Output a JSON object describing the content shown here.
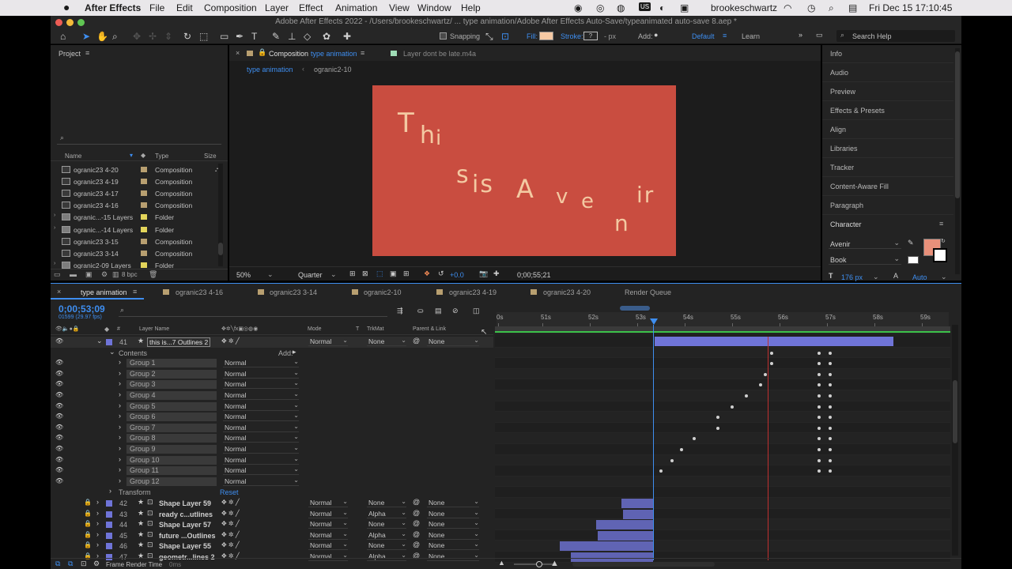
{
  "menubar": {
    "app": "After Effects",
    "items": [
      "File",
      "Edit",
      "Composition",
      "Layer",
      "Effect",
      "Animation",
      "View",
      "Window",
      "Help"
    ],
    "user": "brookeschwartz",
    "clock": "Fri Dec 15  17:10:45"
  },
  "window_title": "Adobe After Effects 2022 - /Users/brookeschwartz/ ... type animation/Adobe After Effects Auto-Save/typeanimated auto-save 8.aep *",
  "toolbar": {
    "snapping": "Snapping",
    "fill": "Fill:",
    "stroke": "Stroke:",
    "stroke_units": "- px",
    "add": "Add:",
    "workspace_default": "Default",
    "workspace_learn": "Learn",
    "search_placeholder": "Search Help",
    "fill_color": "#f6c9a4"
  },
  "project": {
    "title": "Project",
    "columns": {
      "name": "Name",
      "type": "Type",
      "size": "Size"
    },
    "items": [
      {
        "name": "ogranic23 4-20",
        "type": "Composition",
        "color": "#b89f70"
      },
      {
        "name": "ogranic23 4-19",
        "type": "Composition",
        "color": "#b89f70"
      },
      {
        "name": "ogranic23 4-17",
        "type": "Composition",
        "color": "#b89f70"
      },
      {
        "name": "ogranic23 4-16",
        "type": "Composition",
        "color": "#b89f70"
      },
      {
        "name": "ogranic...-15 Layers",
        "type": "Folder",
        "color": "#e3d55a"
      },
      {
        "name": "ogranic...-14 Layers",
        "type": "Folder",
        "color": "#e3d55a"
      },
      {
        "name": "ogranic23 3-15",
        "type": "Composition",
        "color": "#b89f70"
      },
      {
        "name": "ogranic23 3-14",
        "type": "Composition",
        "color": "#b89f70"
      },
      {
        "name": "ogranic2-09 Layers",
        "type": "Folder",
        "color": "#e3d55a"
      }
    ],
    "bpc": "8 bpc"
  },
  "viewer": {
    "tab_label_prefix": "Composition",
    "tab_comp": "type animation",
    "tab_layer": "Layer dont be late.m4a",
    "crumb1": "type animation",
    "crumb2": "ogranic2-10",
    "bg_color": "#c94d40",
    "text_color": "#f3c9a2",
    "glyphs": [
      {
        "c": "T"
      },
      {
        "c": "h"
      },
      {
        "c": "i"
      },
      {
        "c": "s"
      },
      {
        "c": "is"
      },
      {
        "c": "A"
      },
      {
        "c": "v"
      },
      {
        "c": "e"
      },
      {
        "c": "n"
      },
      {
        "c": "ir"
      }
    ],
    "zoom": "50%",
    "resolution": "Quarter",
    "exposure": "+0.0",
    "timecode": "0;00;55;21"
  },
  "right_panel": {
    "items": [
      "Info",
      "Audio",
      "Preview",
      "Effects & Presets",
      "Align",
      "Libraries",
      "Tracker",
      "Content-Aware Fill",
      "Paragraph"
    ],
    "character_title": "Character",
    "font": "Avenir",
    "style": "Book",
    "size": "176 px",
    "leading": "Auto",
    "swatch_color": "#e8907a"
  },
  "timeline": {
    "tabs": [
      "type animation",
      "ogranic23 4-16",
      "ogranic23 3-14",
      "ogranic2-10",
      "ogranic23 4-19",
      "ogranic23 4-20",
      "Render Queue"
    ],
    "timecode": "0;00;53;09",
    "frames": "01599 (29.97 fps)",
    "columns": {
      "layer_name": "Layer Name",
      "mode": "Mode",
      "t": "T",
      "trkmat": "TrkMat",
      "parent": "Parent & Link",
      "num": "#"
    },
    "ruler": [
      "0s",
      "51s",
      "52s",
      "53s",
      "54s",
      "55s",
      "56s",
      "57s",
      "58s",
      "59s"
    ],
    "main_layer": {
      "num": "41",
      "name": "this is...7 Outlines 2",
      "mode": "Normal",
      "trkmat": "None",
      "parent": "None"
    },
    "contents": "Contents",
    "add": "Add:",
    "groups": [
      "Group 1",
      "Group 2",
      "Group 3",
      "Group 4",
      "Group 5",
      "Group 6",
      "Group 7",
      "Group 8",
      "Group 9",
      "Group 10",
      "Group 11",
      "Group 12"
    ],
    "group_mode": "Normal",
    "transform": "Transform",
    "reset": "Reset",
    "layers": [
      {
        "num": "42",
        "name": "Shape Layer 59",
        "mode": "Normal",
        "trkmat": "None",
        "parent": "None"
      },
      {
        "num": "43",
        "name": "ready c...utlines",
        "mode": "Normal",
        "trkmat": "Alpha",
        "parent": "None"
      },
      {
        "num": "44",
        "name": "Shape Layer 57",
        "mode": "Normal",
        "trkmat": "None",
        "parent": "None"
      },
      {
        "num": "45",
        "name": "future ...Outlines",
        "mode": "Normal",
        "trkmat": "Alpha",
        "parent": "None"
      },
      {
        "num": "46",
        "name": "Shape Layer 55",
        "mode": "Normal",
        "trkmat": "None",
        "parent": "None"
      },
      {
        "num": "47",
        "name": "geometr...lines 2",
        "mode": "Normal",
        "trkmat": "Alpha",
        "parent": "None"
      }
    ],
    "frame_render": "Frame Render Time",
    "frame_render_value": "0ms",
    "layer_color": "#6f74d8"
  }
}
